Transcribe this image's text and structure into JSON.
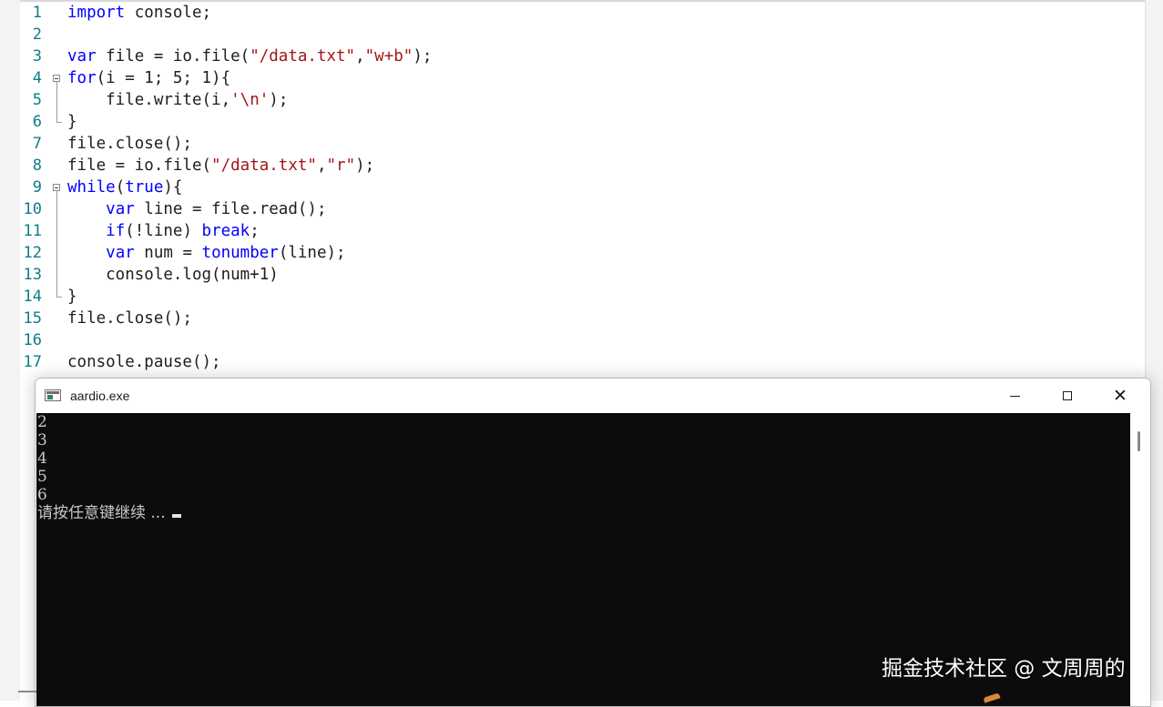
{
  "editor": {
    "line_numbers": [
      "1",
      "2",
      "3",
      "4",
      "5",
      "6",
      "7",
      "8",
      "9",
      "10",
      "11",
      "12",
      "13",
      "14",
      "15",
      "16",
      "17"
    ],
    "lines": [
      [
        {
          "t": "import",
          "c": "kw"
        },
        {
          "t": " console;",
          "c": ""
        }
      ],
      [],
      [
        {
          "t": "var",
          "c": "kw"
        },
        {
          "t": " file = io.file(",
          "c": ""
        },
        {
          "t": "\"/data.txt\"",
          "c": "str"
        },
        {
          "t": ",",
          "c": ""
        },
        {
          "t": "\"w+b\"",
          "c": "str"
        },
        {
          "t": ");",
          "c": ""
        }
      ],
      [
        {
          "t": "for",
          "c": "kw"
        },
        {
          "t": "(i = 1; 5; 1){",
          "c": ""
        }
      ],
      [
        {
          "t": "    file.write(i,",
          "c": ""
        },
        {
          "t": "'\\n'",
          "c": "str"
        },
        {
          "t": ");",
          "c": ""
        }
      ],
      [
        {
          "t": "}",
          "c": ""
        }
      ],
      [
        {
          "t": "file.close();",
          "c": ""
        }
      ],
      [
        {
          "t": "file = io.file(",
          "c": ""
        },
        {
          "t": "\"/data.txt\"",
          "c": "str"
        },
        {
          "t": ",",
          "c": ""
        },
        {
          "t": "\"r\"",
          "c": "str"
        },
        {
          "t": ");",
          "c": ""
        }
      ],
      [
        {
          "t": "while",
          "c": "kw"
        },
        {
          "t": "(",
          "c": ""
        },
        {
          "t": "true",
          "c": "kw"
        },
        {
          "t": "){",
          "c": ""
        }
      ],
      [
        {
          "t": "    ",
          "c": ""
        },
        {
          "t": "var",
          "c": "kw"
        },
        {
          "t": " line = file.read();",
          "c": ""
        }
      ],
      [
        {
          "t": "    ",
          "c": ""
        },
        {
          "t": "if",
          "c": "kw"
        },
        {
          "t": "(!line) ",
          "c": ""
        },
        {
          "t": "break",
          "c": "kw"
        },
        {
          "t": ";",
          "c": ""
        }
      ],
      [
        {
          "t": "    ",
          "c": ""
        },
        {
          "t": "var",
          "c": "kw"
        },
        {
          "t": " num = ",
          "c": ""
        },
        {
          "t": "tonumber",
          "c": "kw"
        },
        {
          "t": "(line);",
          "c": ""
        }
      ],
      [
        {
          "t": "    console.log(num+1)",
          "c": ""
        }
      ],
      [
        {
          "t": "}",
          "c": ""
        }
      ],
      [
        {
          "t": "file.close();",
          "c": ""
        }
      ],
      [],
      [
        {
          "t": "console.pause();",
          "c": ""
        }
      ]
    ],
    "colors": {
      "keyword": "#0000ff",
      "string": "#a31515",
      "line_number": "#0e7c86",
      "text": "#1e1e1e"
    }
  },
  "console_window": {
    "title": "aardio.exe",
    "icon": "console-app-icon",
    "minimize_icon": "minimize-icon",
    "maximize_icon": "maximize-icon",
    "close_label": "✕",
    "output_lines": [
      "2",
      "3",
      "4",
      "5",
      "6"
    ],
    "pause_prompt": "请按任意键继续 ..."
  },
  "watermark": "掘金技术社区 @ 文周周的"
}
